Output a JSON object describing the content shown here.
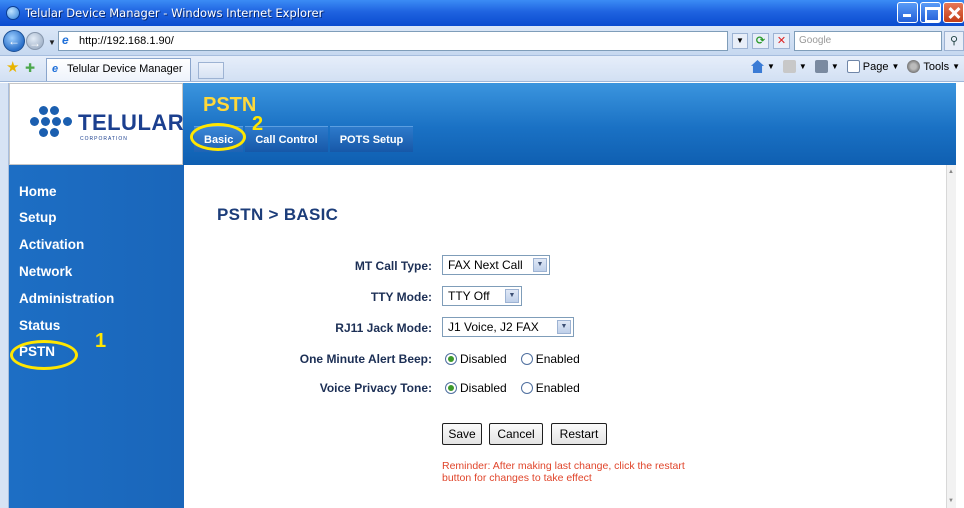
{
  "window": {
    "title": "Telular Device Manager - Windows Internet Explorer",
    "controls": [
      "minimize-icon",
      "maximize-icon",
      "close-icon"
    ]
  },
  "address_bar": {
    "url": "http://192.168.1.90/",
    "search_placeholder": "Google"
  },
  "tabs": [
    {
      "label": "Telular Device Manager"
    }
  ],
  "command_bar": {
    "page_label": "Page",
    "tools_label": "Tools"
  },
  "header": {
    "logo_text": "TELULAR",
    "logo_sub": "CORPORATION",
    "section_title": "PSTN",
    "subtabs": [
      {
        "label": "Basic",
        "active": true
      },
      {
        "label": "Call Control",
        "active": false
      },
      {
        "label": "POTS Setup",
        "active": false
      }
    ]
  },
  "sidebar": {
    "items": [
      {
        "label": "Home"
      },
      {
        "label": "Setup"
      },
      {
        "label": "Activation"
      },
      {
        "label": "Network"
      },
      {
        "label": "Administration"
      },
      {
        "label": "Status"
      },
      {
        "label": "PSTN"
      }
    ]
  },
  "main": {
    "breadcrumb": "PSTN > BASIC",
    "fields": {
      "mt_call_type": {
        "label": "MT Call Type:",
        "value": "FAX Next Call"
      },
      "tty_mode": {
        "label": "TTY Mode:",
        "value": "TTY Off"
      },
      "rj11_jack_mode": {
        "label": "RJ11 Jack Mode:",
        "value": "J1 Voice, J2 FAX"
      },
      "one_minute_alert_beep": {
        "label": "One Minute Alert Beep:",
        "options": [
          "Disabled",
          "Enabled"
        ],
        "selected": "Disabled"
      },
      "voice_privacy_tone": {
        "label": "Voice Privacy Tone:",
        "options": [
          "Disabled",
          "Enabled"
        ],
        "selected": "Disabled"
      }
    },
    "buttons": {
      "save": "Save",
      "cancel": "Cancel",
      "restart": "Restart"
    },
    "reminder": "Reminder: After making last change, click the restart button for changes to take effect"
  },
  "annotations": [
    {
      "label": "1",
      "target": "PSTN"
    },
    {
      "label": "2",
      "target": "Basic"
    }
  ],
  "colors": {
    "header_blue": "#1a71c4",
    "section_title_yellow": "#ffd83a",
    "annotation_yellow": "#ffe600",
    "breadcrumb_navy": "#1c3d7a",
    "reminder_red": "#e0452b",
    "radio_selected_green": "#3d9a2b"
  }
}
